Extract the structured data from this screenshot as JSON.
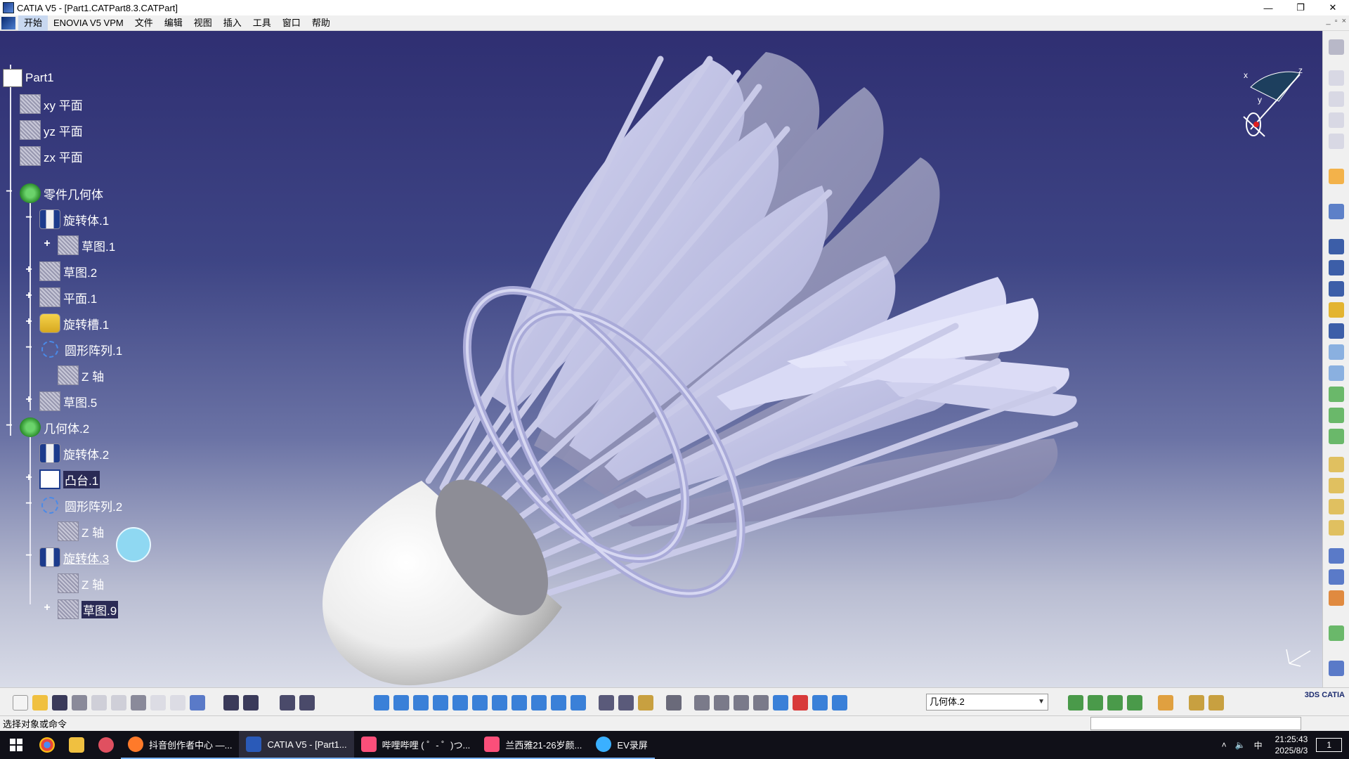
{
  "window": {
    "title": "CATIA V5 - [Part1.CATPart8.3.CATPart]",
    "minimize": "—",
    "maximize": "❐",
    "close": "✕"
  },
  "menu": {
    "items": [
      "开始",
      "ENOVIA V5 VPM",
      "文件",
      "编辑",
      "视图",
      "插入",
      "工具",
      "窗口",
      "帮助"
    ]
  },
  "tree": {
    "root": "Part1",
    "nodes": [
      {
        "label": "xy 平面",
        "icon": "plane-icon"
      },
      {
        "label": "yz 平面",
        "icon": "plane-icon"
      },
      {
        "label": "zx 平面",
        "icon": "plane-icon"
      },
      {
        "label": "零件几何体",
        "icon": "body-icon"
      },
      {
        "label": "旋转体.1",
        "icon": "shaft-icon"
      },
      {
        "label": "草图.1",
        "icon": "sketch-icon"
      },
      {
        "label": "草图.2",
        "icon": "sketch-icon"
      },
      {
        "label": "平面.1",
        "icon": "plane-icon"
      },
      {
        "label": "旋转槽.1",
        "icon": "groove-icon"
      },
      {
        "label": "圆形阵列.1",
        "icon": "circular-pattern-icon"
      },
      {
        "label": "Z 轴",
        "icon": "axis-icon"
      },
      {
        "label": "草图.5",
        "icon": "sketch-icon"
      },
      {
        "label": "几何体.2",
        "icon": "body-icon"
      },
      {
        "label": "旋转体.2",
        "icon": "shaft-icon"
      },
      {
        "label": "凸台.1",
        "icon": "pad-icon"
      },
      {
        "label": "圆形阵列.2",
        "icon": "circular-pattern-icon"
      },
      {
        "label": "Z 轴",
        "icon": "axis-icon"
      },
      {
        "label": "旋转体.3",
        "icon": "shaft-icon"
      },
      {
        "label": "Z 轴",
        "icon": "axis-icon"
      },
      {
        "label": "草图.9",
        "icon": "sketch-icon"
      }
    ]
  },
  "compass_axes": {
    "x": "x",
    "y": "y",
    "z": "z"
  },
  "bottom_toolbar": {
    "current_body": "几何体.2"
  },
  "status": {
    "prompt": "选择对象或命令"
  },
  "taskbar": {
    "apps": [
      {
        "label": "抖音创作者中心 —...",
        "icon": "firefox-icon",
        "color": "#ff7a2a"
      },
      {
        "label": "CATIA V5 - [Part1...",
        "icon": "catia-icon",
        "color": "#2a5ab8"
      },
      {
        "label": "哔哩哔哩 ( ゜- ゜)つ...",
        "icon": "bilibili-icon",
        "color": "#fb4f7a"
      },
      {
        "label": "兰西雅21-26岁颜...",
        "icon": "bilibili-icon",
        "color": "#fb4f7a"
      },
      {
        "label": "EV录屏",
        "icon": "ev-recorder-icon",
        "color": "#3ab0ff"
      }
    ],
    "ime": "中",
    "time": "21:25:43",
    "date": "2025/8/3",
    "notification_count": "1"
  },
  "colors": {
    "viewport_top": "#2f2f72",
    "viewport_bottom": "#d9dce8",
    "feather": "#c8c9ea",
    "cork": "#f2f2f2"
  }
}
